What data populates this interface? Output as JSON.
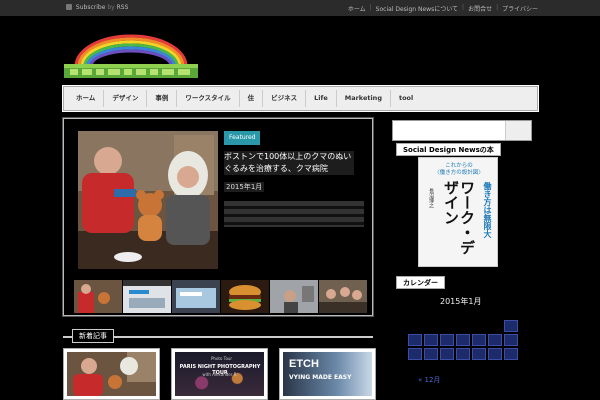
{
  "topbar": {
    "subscribe_label": "Subscribe",
    "subscribe_by": "by",
    "rss_label": "RSS",
    "links": [
      "ホーム",
      "Social Design Newsについて",
      "お問合せ",
      "プライバシー"
    ]
  },
  "nav": {
    "items": [
      "ホーム",
      "デザイン",
      "事例",
      "ワークスタイル",
      "住",
      "ビジネス",
      "Life",
      "Marketing",
      "tool"
    ]
  },
  "featured": {
    "badge": "Featured",
    "title": "ボストンで100体以上のクマのぬいぐるみを治療する、クマ病院",
    "meta": "2015年1月",
    "excerpt": ""
  },
  "section": {
    "title": "新着記事"
  },
  "cards": [
    {
      "caption": ""
    },
    {
      "caption_small": "Photo Tour",
      "caption": "PARIS NIGHT PHOTOGRAPHY TOUR",
      "caption_sub": "with Alexander R."
    },
    {
      "caption": "ETCH",
      "caption_sub": "VYING MADE EASY"
    }
  ],
  "thumbs": [
    "bear-hospital",
    "etch-web",
    "etch-app",
    "burger",
    "office",
    "party",
    "city"
  ],
  "sidebar": {
    "search_placeholder": "",
    "book_widget_title": "Social Design Newsの本",
    "book": {
      "subtitle": "これからの\n〈働き方の設計図〉",
      "title": "ワーク・デザイン",
      "tagline": "働き方は無限大",
      "author": "長沼博之"
    },
    "calendar_widget_title": "カレンダー",
    "calendar_month": "2015年1月",
    "calendar_prev": "« 12月"
  },
  "colors": {
    "featured_badge": "#2a98a8",
    "calendar_cell": "#1d2b6a",
    "topbar_bg": "#2b2b2b",
    "nav_bg": "#eeeeee"
  },
  "icons": [
    "rss-icon",
    "rainbow-logo",
    "search-icon"
  ]
}
